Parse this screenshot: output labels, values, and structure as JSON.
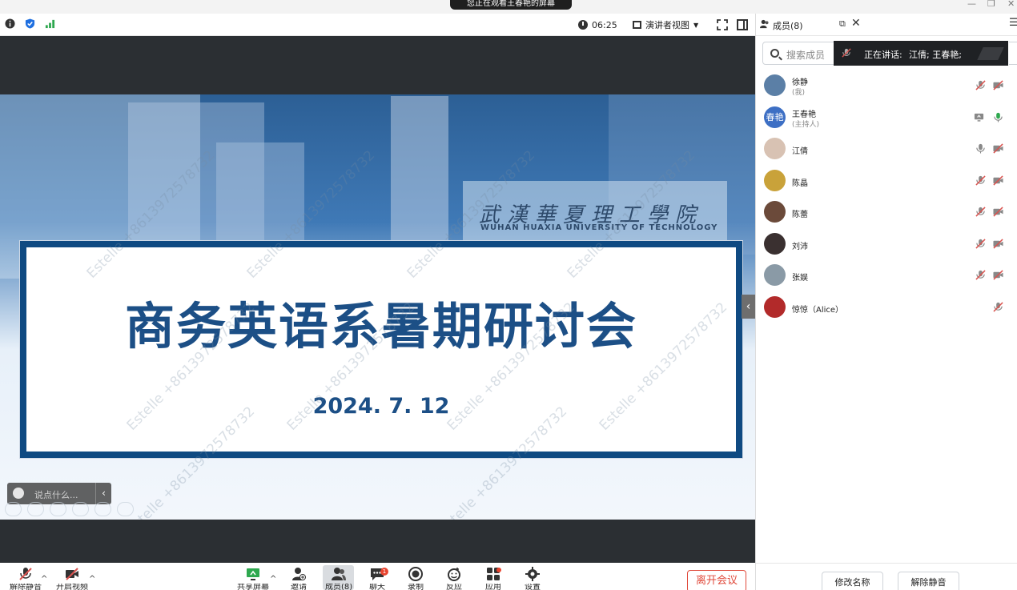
{
  "window": {
    "share_banner": "您正在观看王春艳的屏幕",
    "minimize": "—",
    "restore": "❐",
    "close": "✕"
  },
  "toolbar": {
    "timer": "06:25",
    "view_label": "演讲者视图"
  },
  "slide": {
    "title": "商务英语系暑期研讨会",
    "date": "2024. 7. 12",
    "sign_cn": "武漢華夏理工學院",
    "sign_en": "WUHAN HUAXIA UNIVERSITY OF TECHNOLOGY",
    "watermark": "Estelle +8613972578732"
  },
  "chat": {
    "placeholder": "说点什么...",
    "collapse": "‹"
  },
  "bottom_bar": {
    "unmute": "解除静音",
    "start_video": "开启视频",
    "share_screen": "共享屏幕",
    "invite": "邀请",
    "members": "成员(8)",
    "chat": "聊天",
    "chat_badge": "1",
    "record": "录制",
    "reactions": "反应",
    "apps": "应用",
    "settings": "设置",
    "leave": "离开会议"
  },
  "panel": {
    "title": "成员(8)",
    "search_placeholder": "搜索成员",
    "speaking_label": "正在讲话:",
    "speaking_names": "江倩; 王春艳;",
    "members": [
      {
        "name": "徐静",
        "role": "(我)",
        "avatar_color": "#5b7fa6"
      },
      {
        "name": "王春艳",
        "role": "(主持人)",
        "avatar_text": "春艳",
        "avatar_color": "#3d6fc4"
      },
      {
        "name": "江倩",
        "role": "",
        "avatar_color": "#d8c2b3"
      },
      {
        "name": "陈晶",
        "role": "",
        "avatar_color": "#c9a23a"
      },
      {
        "name": "陈蕾",
        "role": "",
        "avatar_color": "#6b4a3a"
      },
      {
        "name": "刘沛",
        "role": "",
        "avatar_color": "#3a3030"
      },
      {
        "name": "张娱",
        "role": "",
        "avatar_color": "#8a9aa6"
      },
      {
        "name": "惊惊（Alice）",
        "role": "",
        "avatar_color": "#b22a2a"
      }
    ],
    "rename_button": "修改名称",
    "unmute_all_button": "解除静音"
  },
  "colors": {
    "accent_blue": "#1c4f86",
    "leave_red": "#e04a3b",
    "muted_red": "#d9534f",
    "mic_green": "#2ea84f"
  }
}
